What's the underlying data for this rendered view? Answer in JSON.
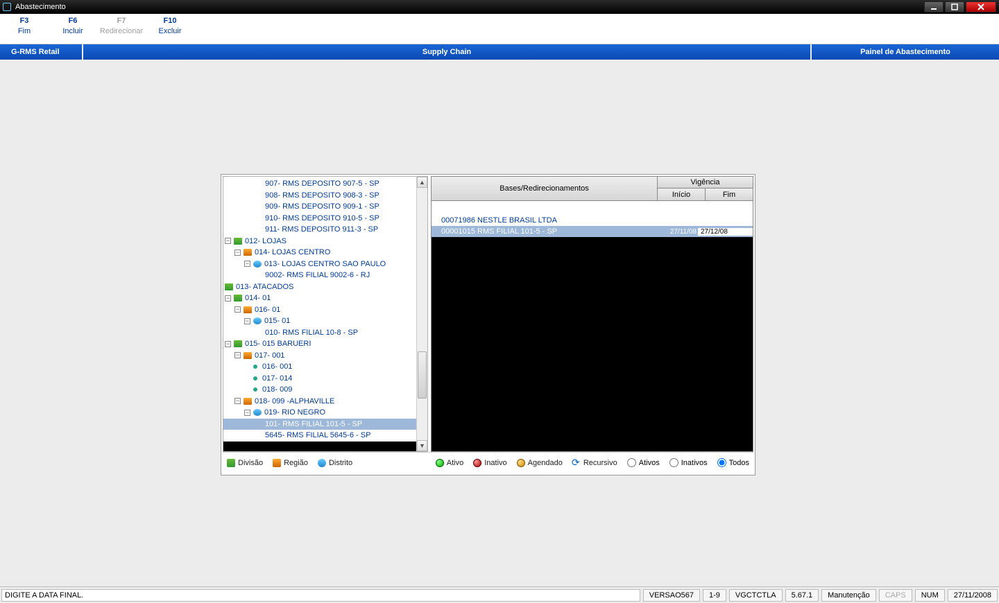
{
  "window": {
    "title": "Abastecimento"
  },
  "fkeys": [
    {
      "key": "F3",
      "label": "Fim",
      "disabled": false
    },
    {
      "key": "F6",
      "label": "Incluir",
      "disabled": false
    },
    {
      "key": "F7",
      "label": "Redirecionar",
      "disabled": true
    },
    {
      "key": "F10",
      "label": "Excluir",
      "disabled": false
    }
  ],
  "bluebar": {
    "left": "G-RMS Retail",
    "center": "Supply Chain",
    "right": "Painel de Abastecimento"
  },
  "tree": [
    {
      "indent": 60,
      "exp": "",
      "icon": "",
      "label": "907- RMS DEPOSITO 907-5 - SP",
      "sel": false
    },
    {
      "indent": 60,
      "exp": "",
      "icon": "",
      "label": "908- RMS DEPOSITO 908-3 - SP",
      "sel": false
    },
    {
      "indent": 60,
      "exp": "",
      "icon": "",
      "label": "909- RMS DEPOSITO 909-1 - SP",
      "sel": false
    },
    {
      "indent": 60,
      "exp": "",
      "icon": "",
      "label": "910- RMS DEPOSITO 910-5 - SP",
      "sel": false
    },
    {
      "indent": 60,
      "exp": "",
      "icon": "",
      "label": "911- RMS DEPOSITO 911-3 - SP",
      "sel": false
    },
    {
      "indent": 2,
      "exp": "-",
      "icon": "div",
      "label": "012- LOJAS",
      "sel": false
    },
    {
      "indent": 16,
      "exp": "-",
      "icon": "reg",
      "label": "014- LOJAS CENTRO",
      "sel": false
    },
    {
      "indent": 30,
      "exp": "-",
      "icon": "dis",
      "label": "013- LOJAS CENTRO SAO PAULO",
      "sel": false
    },
    {
      "indent": 60,
      "exp": "",
      "icon": "",
      "label": "9002- RMS FILIAL 9002-6 - RJ",
      "sel": false
    },
    {
      "indent": 2,
      "exp": "",
      "icon": "div",
      "label": "013- ATACADOS",
      "sel": false
    },
    {
      "indent": 2,
      "exp": "-",
      "icon": "div",
      "label": "014- 01",
      "sel": false
    },
    {
      "indent": 16,
      "exp": "-",
      "icon": "reg",
      "label": "016- 01",
      "sel": false
    },
    {
      "indent": 30,
      "exp": "-",
      "icon": "dis",
      "label": "015- 01",
      "sel": false
    },
    {
      "indent": 60,
      "exp": "",
      "icon": "",
      "label": "010- RMS FILIAL 10-8 - SP",
      "sel": false
    },
    {
      "indent": 2,
      "exp": "-",
      "icon": "div",
      "label": "015- 015 BARUERI",
      "sel": false
    },
    {
      "indent": 16,
      "exp": "-",
      "icon": "reg",
      "label": "017- 001",
      "sel": false
    },
    {
      "indent": 40,
      "exp": "",
      "icon": "dot",
      "label": "016- 001",
      "sel": false
    },
    {
      "indent": 40,
      "exp": "",
      "icon": "dot",
      "label": "017- 014",
      "sel": false
    },
    {
      "indent": 40,
      "exp": "",
      "icon": "dot",
      "label": "018- 009",
      "sel": false
    },
    {
      "indent": 16,
      "exp": "-",
      "icon": "reg",
      "label": "018- 099 -ALPHAVILLE",
      "sel": false
    },
    {
      "indent": 30,
      "exp": "-",
      "icon": "dis",
      "label": "019- RIO NEGRO",
      "sel": false
    },
    {
      "indent": 60,
      "exp": "",
      "icon": "",
      "label": "101- RMS FILIAL 101-5 - SP",
      "sel": true
    },
    {
      "indent": 60,
      "exp": "",
      "icon": "",
      "label": "5645- RMS FILIAL 5645-6 - SP",
      "sel": false
    }
  ],
  "grid": {
    "headers": {
      "bases": "Bases/Redirecionamentos",
      "vigencia": "Vigência",
      "inicio": "Início",
      "fim": "Fim"
    },
    "rows": [
      {
        "name": "00071986 NESTLE BRASIL LTDA",
        "d1": "",
        "d2": "",
        "sel": false
      },
      {
        "name": "00001015 RMS FILIAL 101-5 - SP",
        "d1": "27/11/08",
        "d2": "27/12/08",
        "sel": true
      }
    ]
  },
  "legend": {
    "divisao": "Divisão",
    "regiao": "Região",
    "distrito": "Distrito",
    "ativo": "Ativo",
    "inativo": "Inativo",
    "agendado": "Agendado",
    "recursivo": "Recursivo",
    "radio_ativos": "Ativos",
    "radio_inativos": "Inativos",
    "radio_todos": "Todos"
  },
  "status": {
    "message": "DIGITE A DATA FINAL.",
    "cells": [
      "VERSAO567",
      "1-9",
      "VGCTCTLA",
      "5.67.1",
      "Manutenção"
    ],
    "caps": "CAPS",
    "num": "NUM",
    "date": "27/11/2008"
  }
}
